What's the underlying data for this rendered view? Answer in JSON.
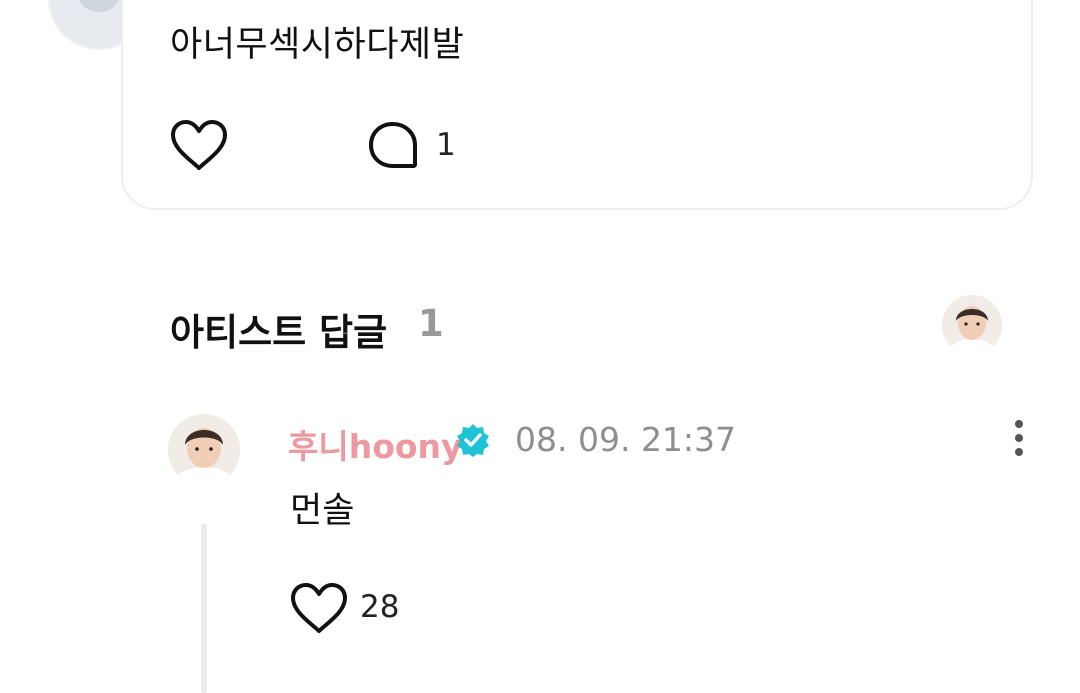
{
  "post": {
    "text": "아너무섹시하다제발",
    "comment_count": "1",
    "icons": {
      "like": "heart-outline-icon",
      "comment": "speech-bubble-icon"
    }
  },
  "artist_replies": {
    "title": "아티스트 답글",
    "count": "1"
  },
  "reply": {
    "author": "후니hoony",
    "verified_icon": "verified-badge-icon",
    "timestamp": "08. 09. 21:37",
    "text": "먼솔",
    "like_count": "28",
    "more_icon": "more-vertical-icon"
  },
  "colors": {
    "author_name": "#ee98a0",
    "verified_badge": "#1fc3d6",
    "muted": "#999999",
    "card_border": "#eceef1"
  }
}
